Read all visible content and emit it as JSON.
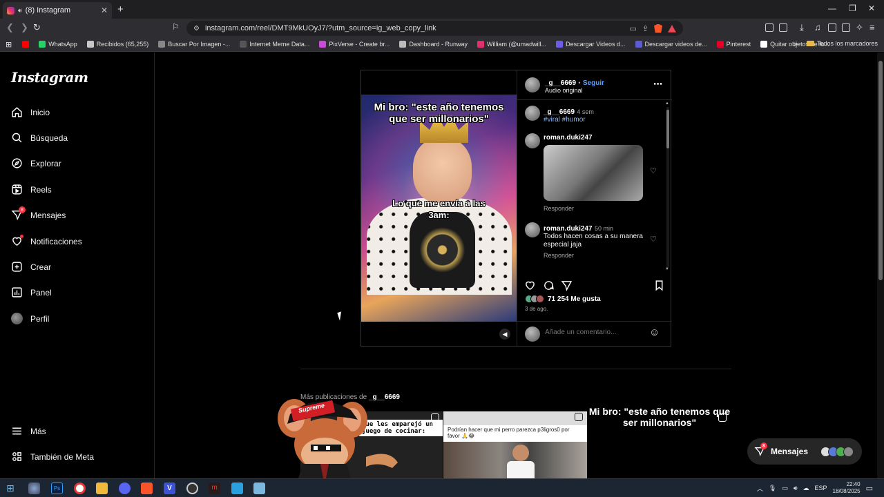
{
  "browser": {
    "tab_title": "(8) Instagram",
    "url": "instagram.com/reel/DMT9MkUOyJ7/?utm_source=ig_web_copy_link",
    "bookmarks": [
      {
        "label": "",
        "color": "#ff0000"
      },
      {
        "label": "WhatsApp",
        "color": "#25d366"
      },
      {
        "label": "Recibidos (65,255)",
        "color": "#c9c9c9"
      },
      {
        "label": "Buscar Por Imagen -...",
        "color": "#888888"
      },
      {
        "label": "Internet Meme Data...",
        "color": "#555555"
      },
      {
        "label": "PixVerse - Create br...",
        "color": "#c94bd6"
      },
      {
        "label": "Dashboard - Runway",
        "color": "#bbbbbb"
      },
      {
        "label": "William (@umadwill...",
        "color": "#e1306c"
      },
      {
        "label": "Descargar Videos d...",
        "color": "#6c5ce7"
      },
      {
        "label": "Descargar videos de...",
        "color": "#5b5bd6"
      },
      {
        "label": "Pinterest",
        "color": "#e60023"
      },
      {
        "label": "Quitar objetos de fo...",
        "color": "#ffffff"
      }
    ],
    "bookmarks_folder": "Todos los marcadores"
  },
  "sidebar": {
    "logo": "Instagram",
    "items": [
      {
        "label": "Inicio",
        "icon": "home-icon"
      },
      {
        "label": "Búsqueda",
        "icon": "search-icon"
      },
      {
        "label": "Explorar",
        "icon": "compass-icon"
      },
      {
        "label": "Reels",
        "icon": "reels-icon"
      },
      {
        "label": "Mensajes",
        "icon": "messenger-icon",
        "badge": "8"
      },
      {
        "label": "Notificaciones",
        "icon": "heart-icon"
      },
      {
        "label": "Crear",
        "icon": "plus-square-icon"
      },
      {
        "label": "Panel",
        "icon": "dashboard-icon"
      },
      {
        "label": "Perfil",
        "icon": "avatar"
      }
    ],
    "bottom": [
      {
        "label": "Más",
        "icon": "menu-icon"
      },
      {
        "label": "También de Meta",
        "icon": "meta-icon"
      }
    ]
  },
  "post": {
    "username": "_g__6669",
    "follow_label": "Seguir",
    "separator": "•",
    "audio": "Audio original",
    "video_caption_top": "Mi bro: \"este año tenemos que ser millonarios\"",
    "video_caption_mid": "Lo que me envía a las 3am:",
    "caption": {
      "user": "_g__6669",
      "time": "4 sem",
      "text": "#viral #humor"
    },
    "comments": [
      {
        "user": "roman.duki247",
        "time": "",
        "text": "",
        "reply": "Responder",
        "has_image": true
      },
      {
        "user": "roman.duki247",
        "time": "50 min",
        "text": "Todos hacen cosas a su manera especial jaja",
        "reply": "Responder",
        "has_image": false
      }
    ],
    "likes": "71 254 Me gusta",
    "date": "3 de ago.",
    "comment_placeholder": "Añade un comentario..."
  },
  "more": {
    "label_prefix": "Más publicaciones de ",
    "label_user": "_g__6669",
    "thumb1_text": "que les emparejó un juego de cocinar:",
    "thumb2_text": "Podrían hacer que mi perro parezca p3ligros0 por favor 🙏😂",
    "thumb3_text": "Mi bro: \"este año tenemos que ser millonarios\"",
    "sticker_text": "Supreme"
  },
  "messages_pill": {
    "label": "Mensajes",
    "badge": "8"
  },
  "taskbar": {
    "lang": "ESP",
    "time": "22:40",
    "date": "18/08/2025"
  }
}
